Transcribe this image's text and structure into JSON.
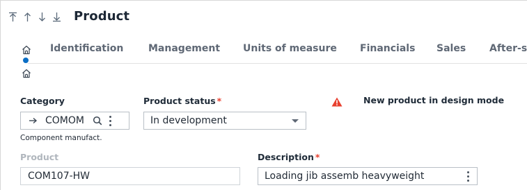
{
  "header": {
    "title": "Product",
    "nav_icons": [
      "arrow-to-first-icon",
      "arrow-up-icon",
      "arrow-down-icon",
      "arrow-to-last-icon"
    ]
  },
  "tabs": [
    {
      "label": "Identification"
    },
    {
      "label": "Management"
    },
    {
      "label": "Units of measure"
    },
    {
      "label": "Financials"
    },
    {
      "label": "Sales"
    },
    {
      "label": "After-sa"
    }
  ],
  "form": {
    "category": {
      "label": "Category",
      "value": "COMOM",
      "description": "Component manufact."
    },
    "product_status": {
      "label": "Product status",
      "required_mark": "*",
      "value": "In development"
    },
    "warning": {
      "text": "New product in design mode"
    },
    "product": {
      "label": "Product",
      "value": "COM107-HW"
    },
    "description": {
      "label": "Description",
      "required_mark": "*",
      "value": "Loading jib assemb heavyweight"
    }
  },
  "colors": {
    "accent": "#0b6ec5",
    "required": "#e8402f",
    "warning": "#e8402f"
  }
}
